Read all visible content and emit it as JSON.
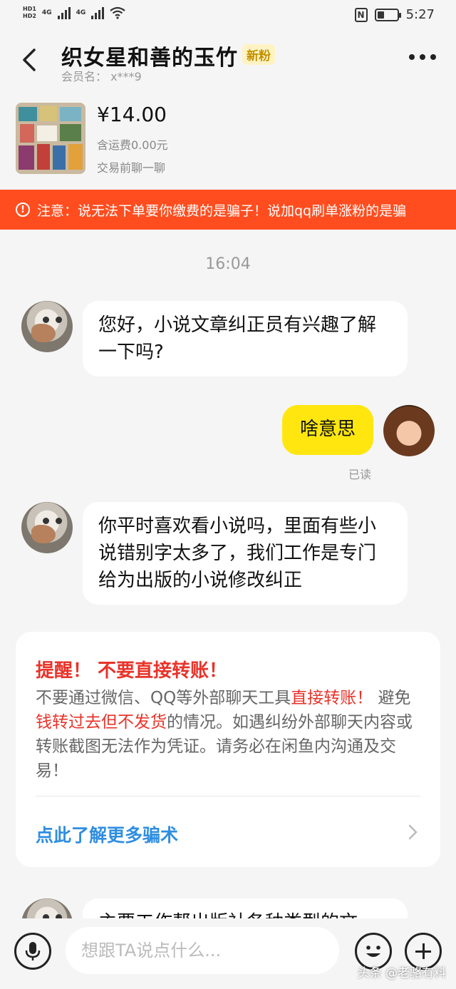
{
  "status_bar": {
    "hd1": "HD1",
    "hd2": "HD2",
    "net1": "4G",
    "net2": "4G",
    "nfc": "N",
    "time": "5:27"
  },
  "header": {
    "title": "织女星和善的玉竹",
    "badge": "新粉",
    "member": "会员名： x***9"
  },
  "product": {
    "price": "¥14.00",
    "shipping": "含运费0.00元",
    "chat_before": "交易前聊一聊"
  },
  "warning_banner": {
    "text": "注意：说无法下单要你缴费的是骗子！说加qq刷单涨粉的是骗"
  },
  "chat": {
    "timestamp": "16:04",
    "messages": [
      {
        "from": "other",
        "text": "您好，小说文章纠正员有兴趣了解一下吗?"
      },
      {
        "from": "me",
        "text": "啥意思",
        "status": "已读"
      },
      {
        "from": "other",
        "text": "你平时喜欢看小说吗，里面有些小说错别字太多了，我们工作是专门给为出版的小说修改纠正"
      },
      {
        "from": "other",
        "text": "主要工作帮出版社各种类型的文"
      }
    ],
    "reminder": {
      "title": "提醒！ 不要直接转账！",
      "body_1": "不要通过微信、QQ等外部聊天工具",
      "body_red_1": "直接转账！",
      "body_2": "避免",
      "body_red_2": "钱转过去但不发货",
      "body_3": "的情况。如遇纠纷外部聊天内容或转账截图无法作为凭证。请务必在闲鱼内沟通及交易！",
      "link": "点此了解更多骗术"
    }
  },
  "input_bar": {
    "placeholder": "想跟TA说点什么..."
  },
  "watermark": "头条 @老骆有料",
  "colors": {
    "accent_yellow": "#ffe60f",
    "warning_orange": "#ff4d1f",
    "alert_red": "#e8332a",
    "link_blue": "#2f8ee0"
  }
}
